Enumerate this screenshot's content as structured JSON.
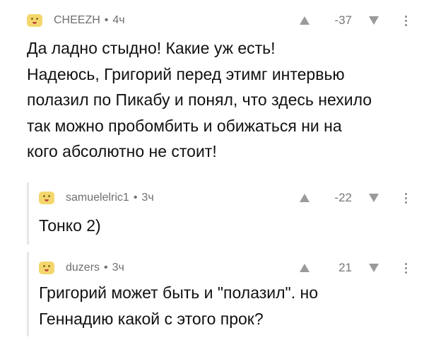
{
  "comments": [
    {
      "author": "CHEEZH",
      "separator": "•",
      "time": "4ч",
      "score": "-37",
      "text": "Да ладно стыдно! Какие уж есть!\nНадеюсь, Григорий перед этимг интервью\nполазил по Пикабу и понял, что здесь нехило\nтак можно пробомбить и обижаться ни на\nкого абсолютно не стоит!"
    },
    {
      "author": "samuelelric1",
      "separator": "•",
      "time": "3ч",
      "score": "-22",
      "text": "Тонко 2)"
    },
    {
      "author": "duzers",
      "separator": "•",
      "time": "3ч",
      "score": "21",
      "text": "Григорий может быть и \"полазил\". но\nГеннадию какой с этого прок?"
    }
  ],
  "icons": {
    "avatar": "avatar-icon",
    "upvote": "arrow-up-icon",
    "downvote": "arrow-down-icon",
    "more": "more-vertical-icon"
  },
  "colors": {
    "meta_text": "#6f6f6f",
    "arrow": "#9a9a9a",
    "thread_line": "#e6e6e6",
    "avatar_bg": "#f3d76d"
  }
}
